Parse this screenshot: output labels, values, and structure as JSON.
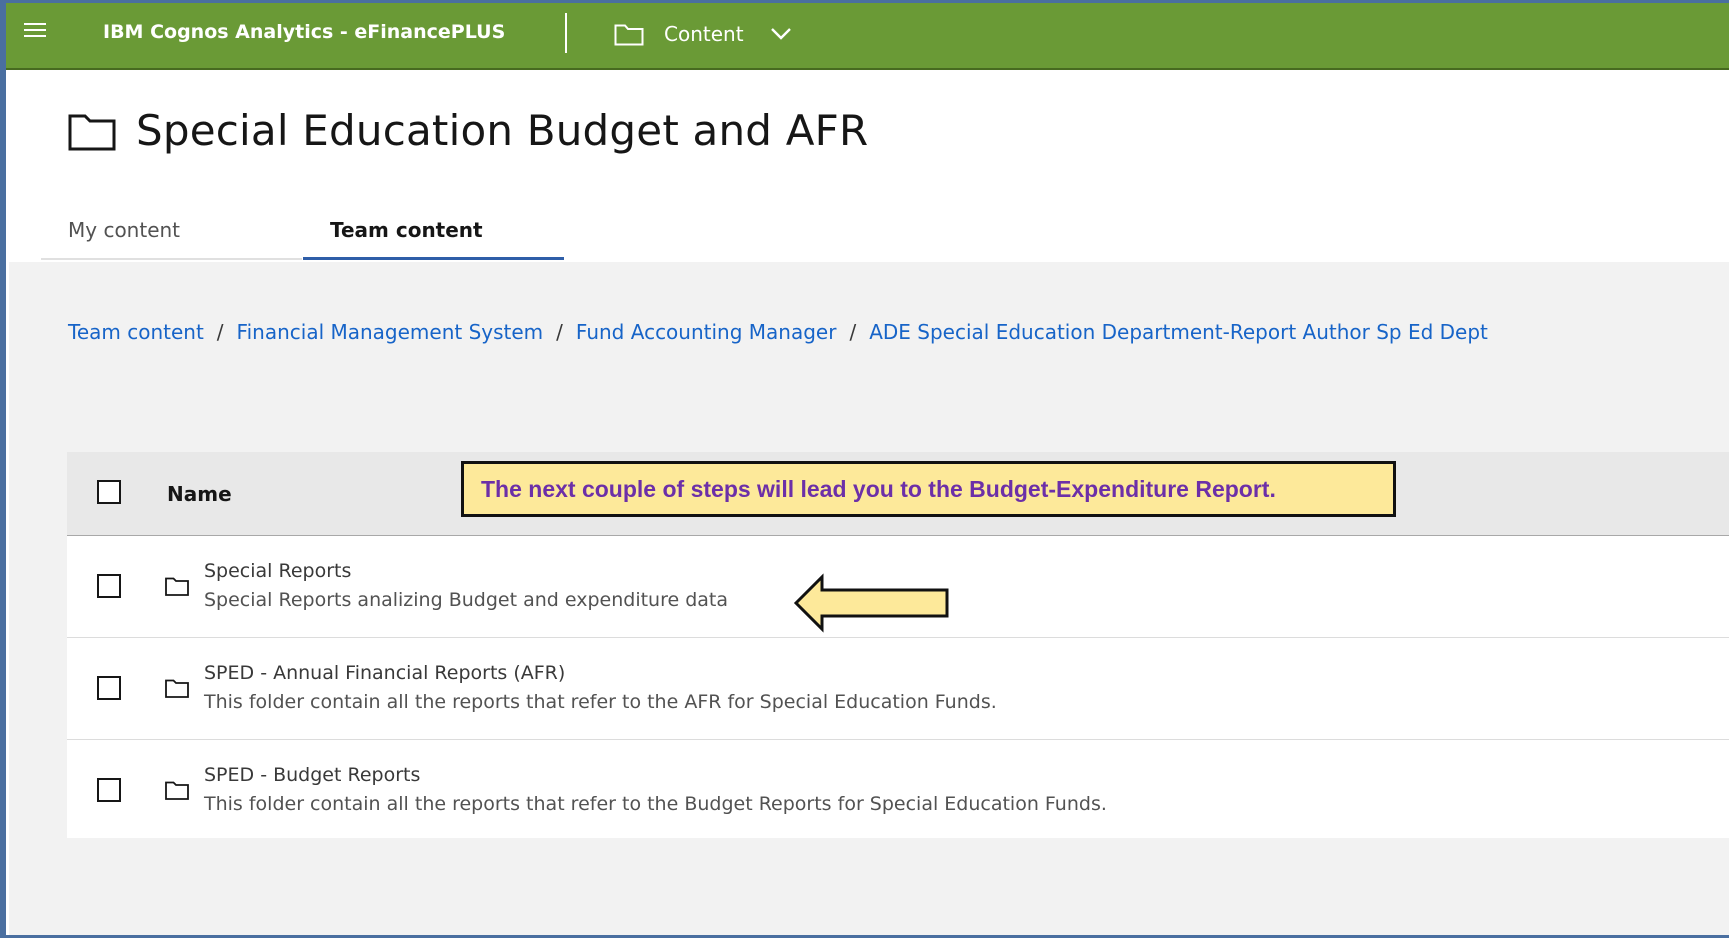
{
  "topbar": {
    "app_title": "IBM Cognos Analytics - eFinancePLUS",
    "content_label": "Content",
    "bg_color": "#6a9a36",
    "icons": [
      "hamburger-icon",
      "folder-icon",
      "chevron-down-icon"
    ]
  },
  "page": {
    "title": "Special Education Budget and AFR",
    "title_icon": "folder-icon"
  },
  "tabs": [
    {
      "label": "My content",
      "active": false
    },
    {
      "label": "Team content",
      "active": true
    }
  ],
  "breadcrumb": [
    "Team content",
    "Financial Management System",
    "Fund Accounting Manager",
    "ADE Special Education Department-Report Author Sp Ed Dept"
  ],
  "table": {
    "header_name": "Name",
    "rows": [
      {
        "name": "Special Reports",
        "description": "Special Reports analizing Budget and expenditure data",
        "icon": "folder-icon"
      },
      {
        "name": "SPED - Annual Financial Reports (AFR)",
        "description": "This folder contain all the reports that refer to the AFR for Special Education Funds.",
        "icon": "folder-icon"
      },
      {
        "name": "SPED - Budget Reports",
        "description": "This folder contain all the reports that refer to the Budget Reports for Special Education Funds.",
        "icon": "folder-icon"
      }
    ]
  },
  "annotation": {
    "callout_text": "The next couple of steps will lead you to the Budget-Expenditure Report.",
    "callout_bg": "#fde99a",
    "callout_text_color": "#6c2fa8",
    "arrow_icon": "left-arrow-icon"
  }
}
